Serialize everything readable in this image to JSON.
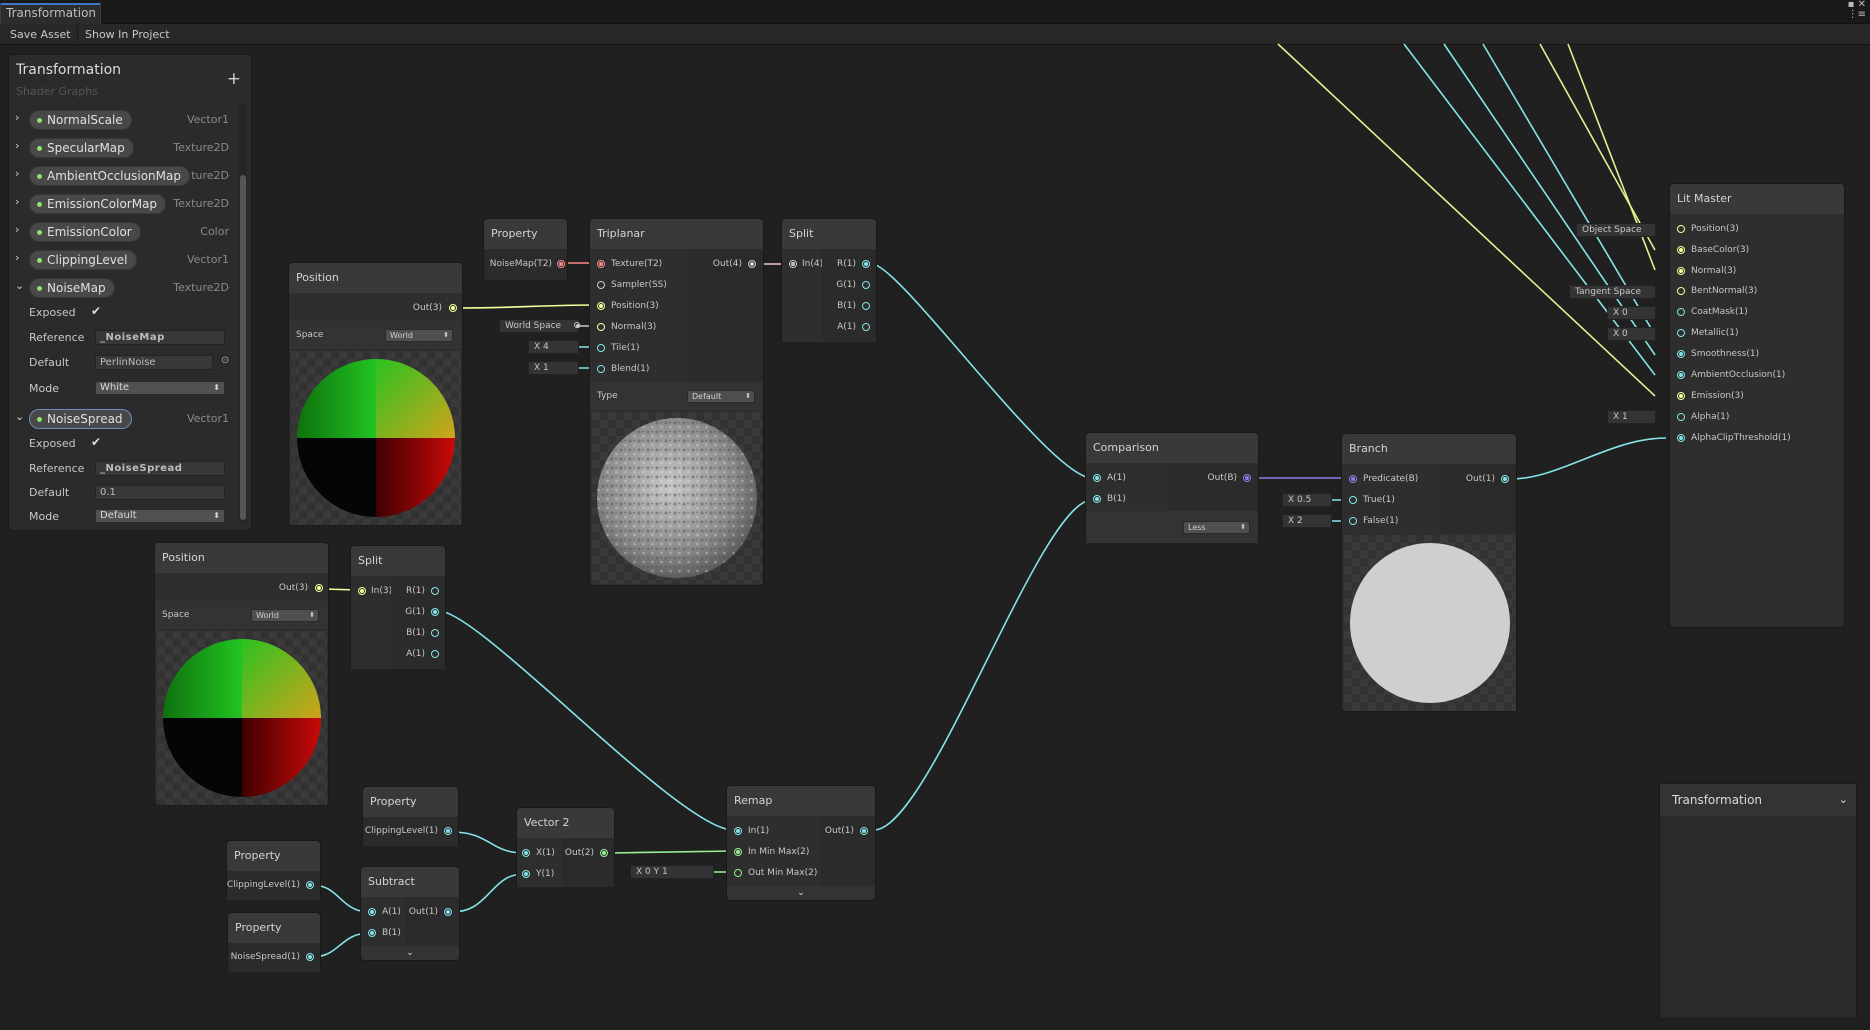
{
  "window": {
    "tab_title": "Transformation",
    "controls": "▪ ✕",
    "menu_glyph": "⋮≡"
  },
  "toolbar": {
    "save_asset": "Save Asset",
    "show_in_project": "Show In Project"
  },
  "blackboard": {
    "title": "Transformation",
    "subtitle": "Shader Graphs",
    "add": "+",
    "properties": [
      {
        "name": "NormalScale",
        "type": "Vector1",
        "arrow": "›"
      },
      {
        "name": "SpecularMap",
        "type": "Texture2D",
        "arrow": "›"
      },
      {
        "name": "AmbientOcclusionMap",
        "type": "ture2D",
        "arrow": "›"
      },
      {
        "name": "EmissionColorMap",
        "type": "Texture2D",
        "arrow": "›"
      },
      {
        "name": "EmissionColor",
        "type": "Color",
        "arrow": "›"
      },
      {
        "name": "ClippingLevel",
        "type": "Vector1",
        "arrow": "›"
      },
      {
        "name": "NoiseMap",
        "type": "Texture2D",
        "arrow": "⌄"
      }
    ],
    "noisemap": {
      "exposed_label": "Exposed",
      "exposed_check": "✔",
      "reference_label": "Reference",
      "reference": "_NoiseMap",
      "default_label": "Default",
      "default": "PerlinNoise",
      "default_picker": "⊙",
      "mode_label": "Mode",
      "mode": "White"
    },
    "noisespread_prop": {
      "name": "NoiseSpread",
      "type": "Vector1",
      "arrow": "⌄"
    },
    "noisespread": {
      "exposed_label": "Exposed",
      "exposed_check": "✔",
      "reference_label": "Reference",
      "reference": "_NoiseSpread",
      "default_label": "Default",
      "default": "0.1",
      "mode_label": "Mode",
      "mode": "Default"
    }
  },
  "nodes": {
    "property_noisemap": {
      "title": "Property",
      "out": "NoiseMap(T2)"
    },
    "position1": {
      "title": "Position",
      "out": "Out(3)",
      "space_label": "Space",
      "space": "World"
    },
    "triplanar": {
      "title": "Triplanar",
      "inputs": [
        "Texture(T2)",
        "Sampler(SS)",
        "Position(3)",
        "Normal(3)",
        "Tile(1)",
        "Blend(1)"
      ],
      "out": "Out(4)",
      "type_label": "Type",
      "type": "Default",
      "normal_default": "World Space",
      "tile_default": "X  4",
      "blend_default": "X  1"
    },
    "split1": {
      "title": "Split",
      "in": "In(4)",
      "outs": [
        "R(1)",
        "G(1)",
        "B(1)",
        "A(1)"
      ]
    },
    "position2": {
      "title": "Position",
      "out": "Out(3)",
      "space_label": "Space",
      "space": "World"
    },
    "split2": {
      "title": "Split",
      "in": "In(3)",
      "outs": [
        "R(1)",
        "G(1)",
        "B(1)",
        "A(1)"
      ]
    },
    "comparison": {
      "title": "Comparison",
      "inputs": [
        "A(1)",
        "B(1)"
      ],
      "out": "Out(B)",
      "op": "Less"
    },
    "branch": {
      "title": "Branch",
      "inputs": [
        "Predicate(B)",
        "True(1)",
        "False(1)"
      ],
      "out": "Out(1)",
      "true_default": "X  0.5",
      "false_default": "X  2"
    },
    "remap": {
      "title": "Remap",
      "inputs": [
        "In(1)",
        "In Min Max(2)",
        "Out Min Max(2)"
      ],
      "out": "Out(1)",
      "outminmax_default": "X  0     Y  1",
      "expand": "⌄"
    },
    "vector2": {
      "title": "Vector 2",
      "inputs": [
        "X(1)",
        "Y(1)"
      ],
      "out": "Out(2)"
    },
    "property_clip1": {
      "title": "Property",
      "out": "ClippingLevel(1)"
    },
    "property_clip2": {
      "title": "Property",
      "out": "ClippingLevel(1)"
    },
    "property_spread": {
      "title": "Property",
      "out": "NoiseSpread(1)"
    },
    "subtract": {
      "title": "Subtract",
      "inputs": [
        "A(1)",
        "B(1)"
      ],
      "out": "Out(1)",
      "expand": "⌄"
    },
    "litmaster": {
      "title": "Lit Master",
      "inputs": [
        "Position(3)",
        "BaseColor(3)",
        "Normal(3)",
        "BentNormal(3)",
        "CoatMask(1)",
        "Metallic(1)",
        "Smoothness(1)",
        "AmbientOcclusion(1)",
        "Emission(3)",
        "Alpha(1)",
        "AlphaClipThreshold(1)"
      ],
      "position_default": "Object Space",
      "bentnormal_default": "Tangent Space",
      "coatmask_default": "X  0",
      "metallic_default": "X  0",
      "alpha_default": "X  1"
    }
  },
  "inspector": {
    "title": "Transformation",
    "chevron": "⌄"
  },
  "colors": {
    "vector1": "#84e4e7",
    "vector3": "#f6ff9a",
    "vector2": "#9aef92",
    "texture": "#ff8b8b",
    "boolean": "#8c7ee8",
    "accent": "#3e77c9"
  }
}
